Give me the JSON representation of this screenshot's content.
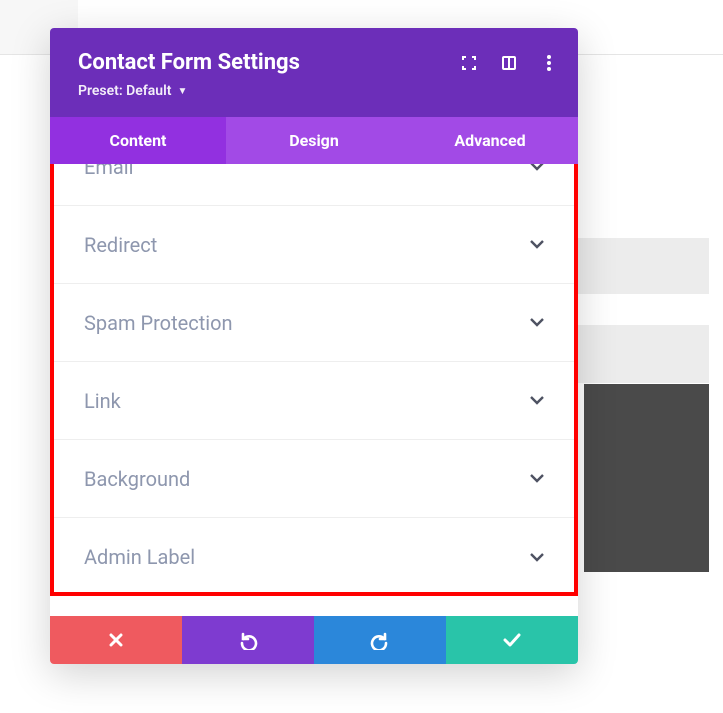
{
  "header": {
    "title": "Contact Form Settings",
    "preset_label": "Preset: Default"
  },
  "tabs": [
    {
      "label": "Content",
      "active": true
    },
    {
      "label": "Design",
      "active": false
    },
    {
      "label": "Advanced",
      "active": false
    }
  ],
  "accordion": [
    {
      "label": "Email"
    },
    {
      "label": "Redirect"
    },
    {
      "label": "Spam Protection"
    },
    {
      "label": "Link"
    },
    {
      "label": "Background"
    },
    {
      "label": "Admin Label"
    }
  ],
  "colors": {
    "header_bg": "#6c2eb9",
    "tabs_bg": "#a24ae6",
    "tab_active_bg": "#9230e0",
    "danger": "#ef5a5f",
    "primary": "#7e3bd0",
    "info": "#2b87da",
    "success": "#29c4a9",
    "highlight_border": "#ff0000"
  }
}
